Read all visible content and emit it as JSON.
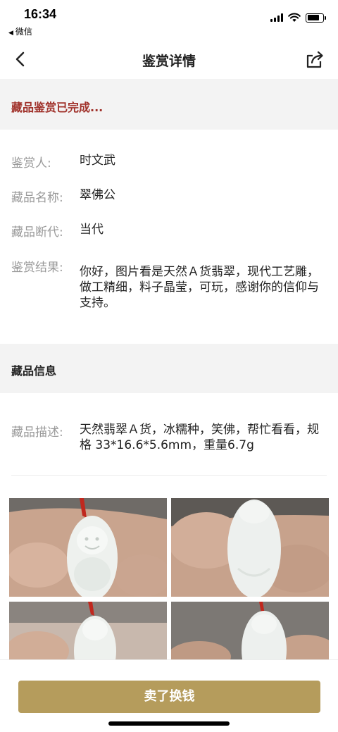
{
  "status_bar": {
    "time": "16:34",
    "back_app": "微信",
    "icons": [
      "cellular-signal-icon",
      "wifi-icon",
      "battery-icon"
    ]
  },
  "nav": {
    "title": "鉴赏详情",
    "back_icon": "chevron-left-icon",
    "share_icon": "share-icon"
  },
  "notice": {
    "text": "藏品鉴赏已完成..."
  },
  "appraisal": {
    "appraiser_label": "鉴赏人:",
    "appraiser_value": "时文武",
    "name_label": "藏品名称:",
    "name_value": "翠佛公",
    "period_label": "藏品断代:",
    "period_value": "当代",
    "result_label": "鉴赏结果:",
    "result_value": "你好，图片看是天然Ａ货翡翠，现代工艺雕，做工精细，料子晶莹，可玩，感谢你的信仰与支持。"
  },
  "item_info": {
    "header": "藏品信息",
    "desc_label": "藏品描述:",
    "desc_value": "天然翡翠Ａ货，冰糯种，笑佛，帮忙看看，规格 33*16.6*5.6mm，重量6.7g"
  },
  "photos": [
    {
      "name": "jade-buddha-front-photo"
    },
    {
      "name": "jade-buddha-back-photo"
    },
    {
      "name": "jade-buddha-front-photo-2"
    },
    {
      "name": "jade-buddha-back-photo-2"
    }
  ],
  "footer": {
    "sell_button": "卖了换钱"
  },
  "colors": {
    "accent_gold": "#b59c5c",
    "notice_red": "#a0312a",
    "section_bg": "#f3f3f3",
    "label_gray": "#9a9a9a"
  }
}
